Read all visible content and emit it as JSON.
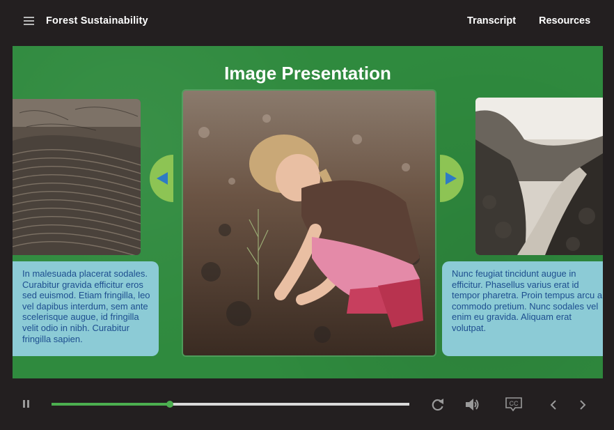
{
  "header": {
    "menu_icon": "hamburger-menu-icon",
    "course_title": "Forest Sustainability",
    "transcript_label": "Transcript",
    "resources_label": "Resources"
  },
  "slide": {
    "title": "Image Presentation",
    "left_caption": "In malesuada placerat sodales. Curabitur gravida efficitur eros sed euismod. Etiam fringilla, leo vel dapibus interdum, sem ante scelerisque augue, id fringilla velit odio in nibh. Curabitur fringilla sapien.",
    "right_caption": "Nunc feugiat tincidunt augue in efficitur. Phasellus varius erat id tempor pharetra. Proin tempus arcu a commodo pretium. Nunc sodales vel enim eu gravida. Aliquam erat volutpat.",
    "left_image": "terraced-hillside-photo",
    "main_image": "child-planting-seedling-photo",
    "right_image": "river-valley-photo",
    "prev_icon": "triangle-left-icon",
    "next_icon": "triangle-right-icon"
  },
  "controls": {
    "progress_fraction": 0.33,
    "icons": [
      "pause-icon",
      "replay-icon",
      "volume-icon",
      "closed-captions-icon",
      "chevron-left-icon",
      "chevron-right-icon"
    ]
  },
  "colors": {
    "background": "#231f20",
    "slide_green": "#2f8a3e",
    "caption_bg": "#8ccbd6",
    "caption_text": "#1d4e8f",
    "arrow_bg": "#8dc454",
    "arrow_glyph": "#2e7bc4",
    "progress": "#4caf50"
  }
}
